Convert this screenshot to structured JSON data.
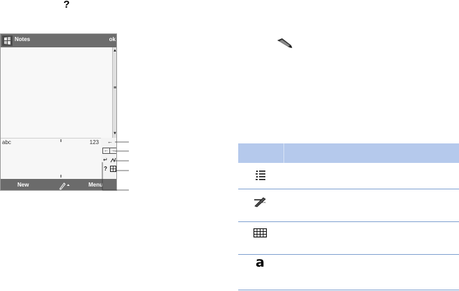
{
  "top_help_glyph": "?",
  "device": {
    "title": "Notes",
    "ok_label": "ok",
    "keyboard": {
      "left_label": "abc",
      "right_label": "123",
      "keys": {
        "backspace": "←",
        "left": "←",
        "right": "→",
        "enter": "↵",
        "help": "?"
      }
    },
    "menubar": {
      "new_label": "New",
      "menu_label": "Menu"
    }
  },
  "pencil_icon": "pencil-icon",
  "table": {
    "header": [
      "",
      ""
    ],
    "rows": [
      {
        "icon": "bulleted-list-icon",
        "description": ""
      },
      {
        "icon": "pen-recognize-icon",
        "description": ""
      },
      {
        "icon": "keyboard-grid-icon",
        "description": ""
      },
      {
        "icon": "letter-a-icon",
        "glyph": "a",
        "description": ""
      }
    ]
  }
}
